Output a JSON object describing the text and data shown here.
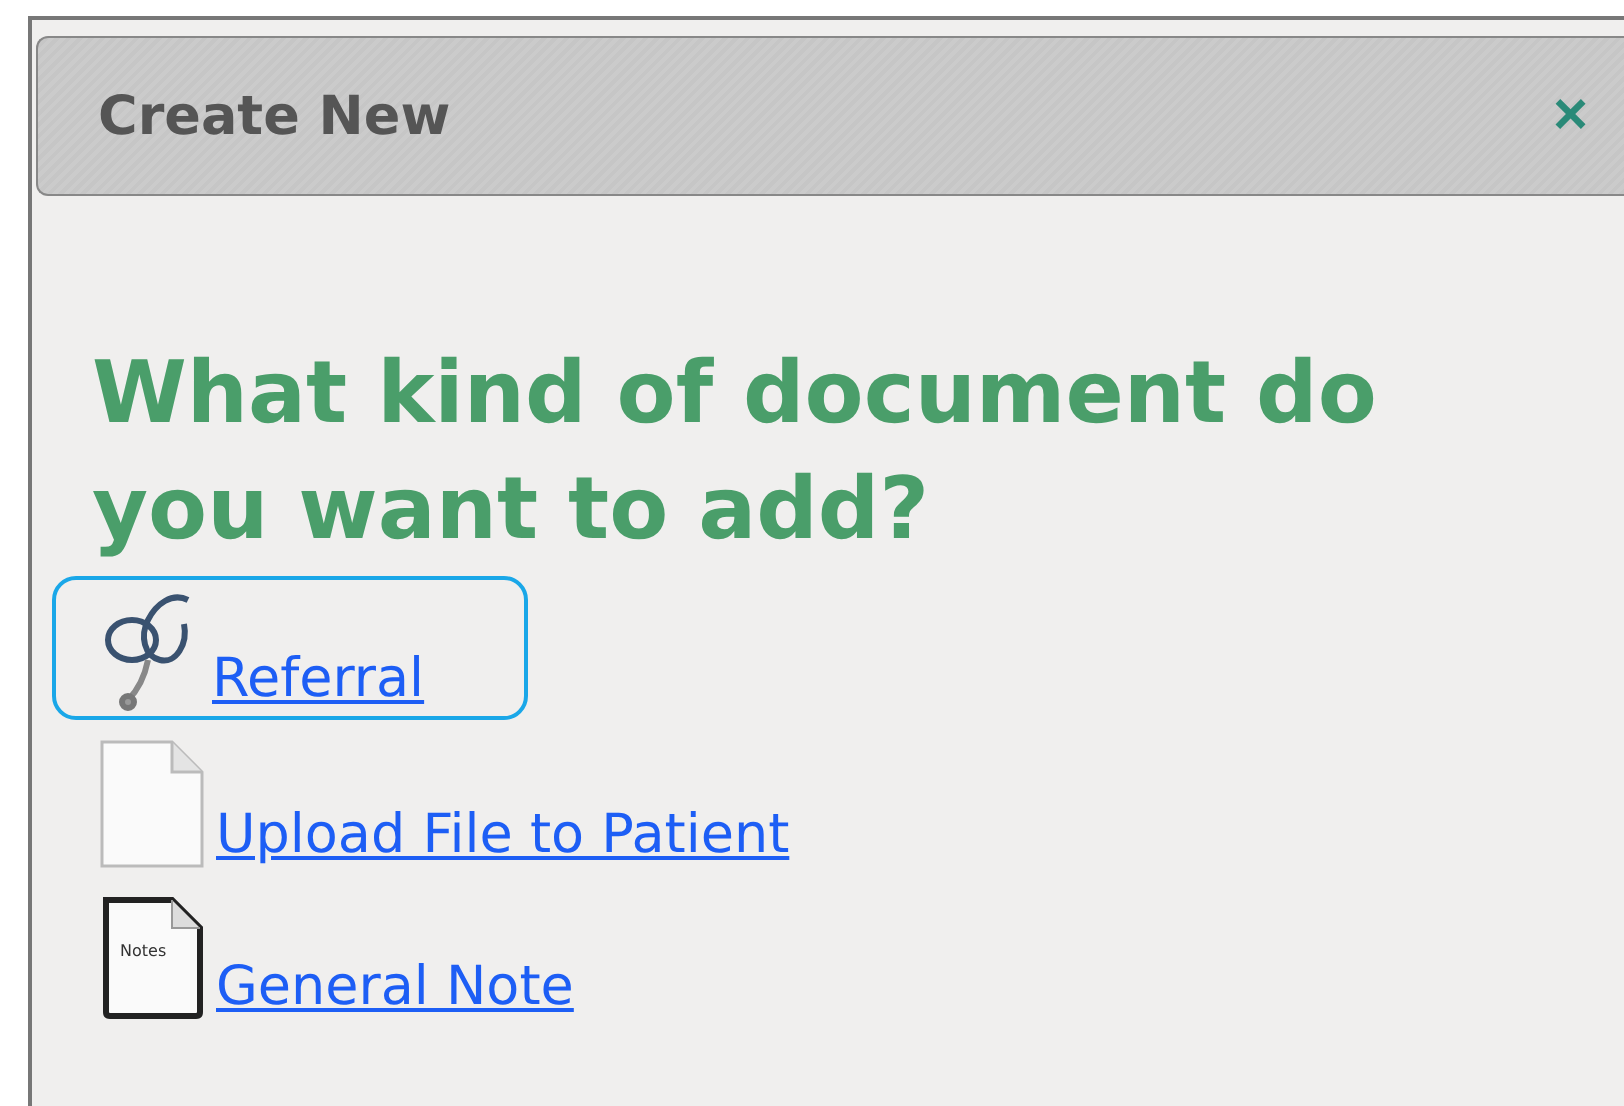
{
  "dialog": {
    "title": "Create New",
    "close": "×"
  },
  "heading": "What kind of document do you want to add?",
  "options": [
    {
      "kind": "stethoscope",
      "label": "Referral",
      "focused": true
    },
    {
      "kind": "blank-file",
      "label": "Upload File to Patient",
      "focused": false
    },
    {
      "kind": "notes-file",
      "label": "General Note",
      "focused": false,
      "icon_label": "Notes"
    }
  ]
}
